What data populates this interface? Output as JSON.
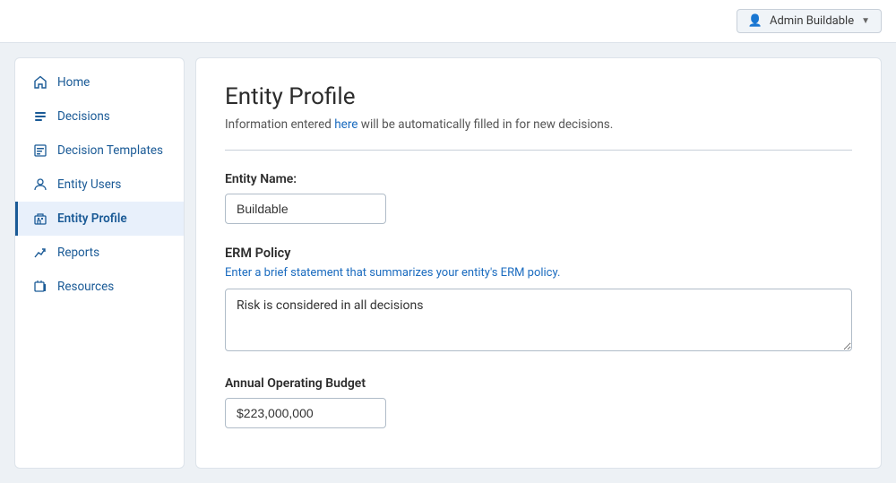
{
  "topNav": {
    "userMenuLabel": "Admin Buildable",
    "userIcon": "👤",
    "chevron": "▼"
  },
  "sidebar": {
    "items": [
      {
        "id": "home",
        "label": "Home",
        "icon": "home",
        "active": false
      },
      {
        "id": "decisions",
        "label": "Decisions",
        "icon": "list",
        "active": false
      },
      {
        "id": "decision-templates",
        "label": "Decision Templates",
        "icon": "template",
        "active": false
      },
      {
        "id": "entity-users",
        "label": "Entity Users",
        "icon": "user",
        "active": false
      },
      {
        "id": "entity-profile",
        "label": "Entity Profile",
        "icon": "building",
        "active": true
      },
      {
        "id": "reports",
        "label": "Reports",
        "icon": "chart",
        "active": false
      },
      {
        "id": "resources",
        "label": "Resources",
        "icon": "resource",
        "active": false
      }
    ]
  },
  "main": {
    "title": "Entity Profile",
    "subtitle": {
      "prefix": "Information entered ",
      "highlight": "here",
      "suffix": " will be automatically filled in for new decisions."
    },
    "entityName": {
      "label": "Entity Name:",
      "value": "Buildable"
    },
    "ermPolicy": {
      "sectionTitle": "ERM Policy",
      "hint": "Enter a brief statement that summarizes your entity's ERM policy.",
      "value": "Risk is considered in all decisions"
    },
    "annualBudget": {
      "label": "Annual Operating Budget",
      "value": "$223,000,000"
    }
  }
}
